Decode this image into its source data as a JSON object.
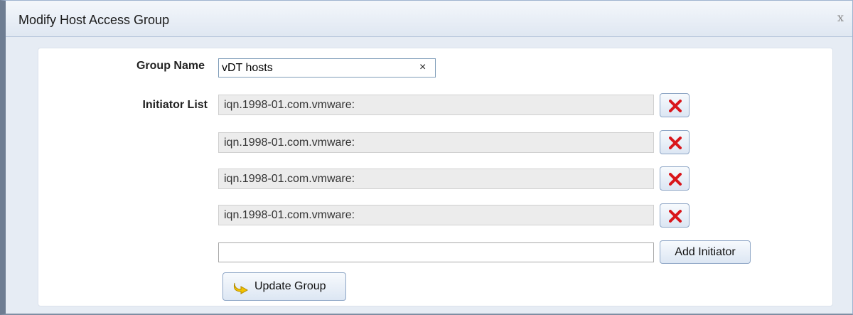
{
  "dialog": {
    "title": "Modify Host Access Group",
    "close_glyph": "x"
  },
  "form": {
    "group_name_label": "Group Name",
    "group_name_value": "vDT hosts",
    "clear_glyph": "×",
    "initiator_list_label": "Initiator List",
    "initiators": [
      "iqn.1998-01.com.vmware:",
      "iqn.1998-01.com.vmware:",
      "iqn.1998-01.com.vmware:",
      "iqn.1998-01.com.vmware:"
    ],
    "new_initiator_value": "",
    "add_initiator_label": "Add Initiator",
    "update_group_label": "Update Group"
  },
  "icons": {
    "close": "close-icon",
    "clear": "clear-input-icon",
    "remove": "red-x-delete-icon",
    "update": "yellow-arrow-icon"
  },
  "colors": {
    "remove_icon": "#d9161b",
    "update_icon": "#f2c200"
  }
}
